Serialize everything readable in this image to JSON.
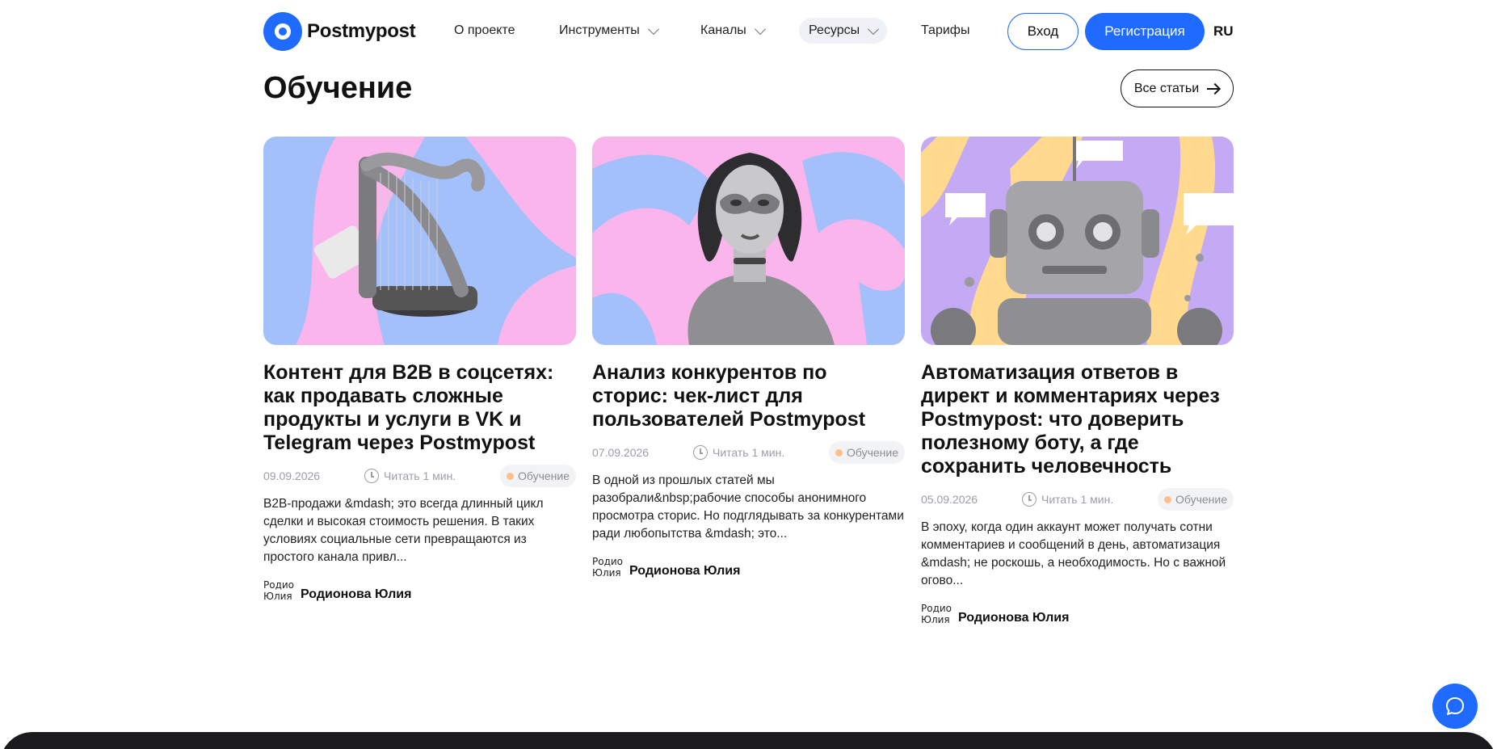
{
  "header": {
    "logo_text": "Postmypost",
    "nav": [
      {
        "label": "О проекте"
      },
      {
        "label": "Инструменты"
      },
      {
        "label": "Каналы"
      },
      {
        "label": "Ресурсы"
      },
      {
        "label": "Тарифы"
      }
    ],
    "login_label": "Вход",
    "register_label": "Регистрация",
    "lang": "RU"
  },
  "section": {
    "title": "Обучение",
    "all_label": "Все статьи"
  },
  "cards": [
    {
      "title": "Контент для B2B в соцсетях: как продавать сложные продукты и услуги в VK и Telegram через Postmypost",
      "date": "09.09.2026",
      "read": "Читать 1 мин.",
      "tag": "Обучение",
      "excerpt": "B2B-продажи &mdash; это всегда длинный цикл сделки и высокая стоимость решения. В таких условиях социальные сети превращаются из простого канала привл...",
      "avatar_alt": "Родионова Юлия",
      "author": "Родионова Юлия"
    },
    {
      "title": "Анализ конкурентов по сторис: чек-лист для пользователей Postmypost",
      "date": "07.09.2026",
      "read": "Читать 1 мин.",
      "tag": "Обучение",
      "excerpt": "В одной из прошлых статей мы разобрали&nbsp;рабочие способы анонимного просмотра сторис. Но подглядывать за конкурентами ради любопытства &mdash; это...",
      "avatar_alt": "Родионова Юлия",
      "author": "Родионова Юлия"
    },
    {
      "title": "Автоматизация ответов в директ и комментариях через Postmypost: что доверить полезному боту, а где сохранить человечность",
      "date": "05.09.2026",
      "read": "Читать 1 мин.",
      "tag": "Обучение",
      "excerpt": "В эпоху, когда один аккаунт может получать сотни комментариев и сообщений в день, автоматизация &mdash; не роскошь, а необходимость. Но с важной огово...",
      "avatar_alt": "Родионова Юлия",
      "author": "Родионова Юлия"
    }
  ],
  "icons": {
    "logo": "postmypost-logo-icon",
    "chevron": "chevron-down-icon",
    "arrow": "arrow-right-icon",
    "clock": "clock-icon",
    "chat": "chat-bubble-icon"
  },
  "colors": {
    "accent": "#1f6bff",
    "tag_dot": "#ffbf8a",
    "footer": "#1b1b1d"
  }
}
